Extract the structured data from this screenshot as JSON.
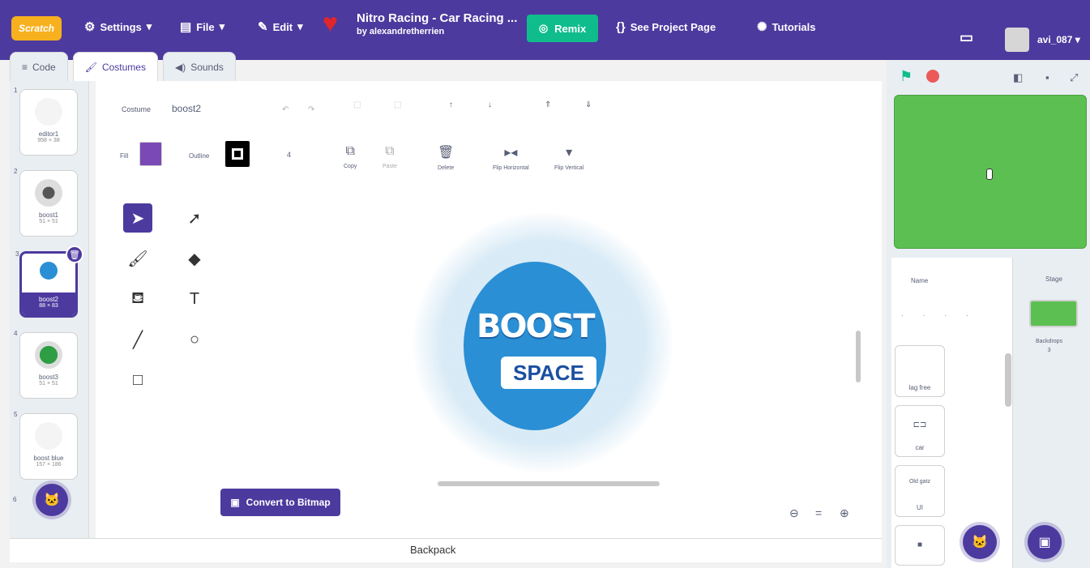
{
  "menu": {
    "logo": "Scratch",
    "settings": "Settings",
    "file": "File",
    "edit": "Edit",
    "project_title": "Nitro Racing - Car Racing ...",
    "project_author": "by alexandretherrien",
    "remix": "Remix",
    "see_project_page": "See Project Page",
    "tutorials": "Tutorials",
    "username": "avi_087"
  },
  "tabs": {
    "code": "Code",
    "costumes": "Costumes",
    "sounds": "Sounds"
  },
  "costumes": [
    {
      "num": "1",
      "name": "editor1",
      "size": "958 × 38"
    },
    {
      "num": "2",
      "name": "boost1",
      "size": "51 × 51"
    },
    {
      "num": "3",
      "name": "boost2",
      "size": "88 × 83"
    },
    {
      "num": "4",
      "name": "boost3",
      "size": "51 × 51"
    },
    {
      "num": "5",
      "name": "boost blue",
      "size": "157 × 186"
    }
  ],
  "costume_list_next_num": "6",
  "editor": {
    "costume_label": "Costume",
    "costume_name": "boost2",
    "fill_label": "Fill",
    "outline_label": "Outline",
    "outline_width": "4",
    "actions": {
      "copy": "Copy",
      "paste": "Paste",
      "delete": "Delete",
      "flip_horizontal": "Flip Horizontal",
      "flip_vertical": "Flip Vertical"
    },
    "canvas_text_top": "BOOST",
    "canvas_text_bottom": "SPACE",
    "convert_button": "Convert to Bitmap",
    "backpack": "Backpack"
  },
  "colors": {
    "menubar": "#4d3a9e",
    "remix": "#0fbd8c",
    "fill": "#7a49b6",
    "stage_bg": "#5cbf52"
  },
  "stage_panel": {
    "name_label": "Name",
    "stage_label": "Stage",
    "backdrops_label": "Backdrops",
    "backdrops_count": "3",
    "sprites": [
      {
        "name": "lag free",
        "icon": ""
      },
      {
        "name": "car",
        "icon": "car-icon"
      },
      {
        "name": "UI",
        "icon": "ui-icon",
        "top_text": "Old gatz"
      },
      {
        "name": "",
        "icon": "sprite-icon"
      }
    ]
  }
}
